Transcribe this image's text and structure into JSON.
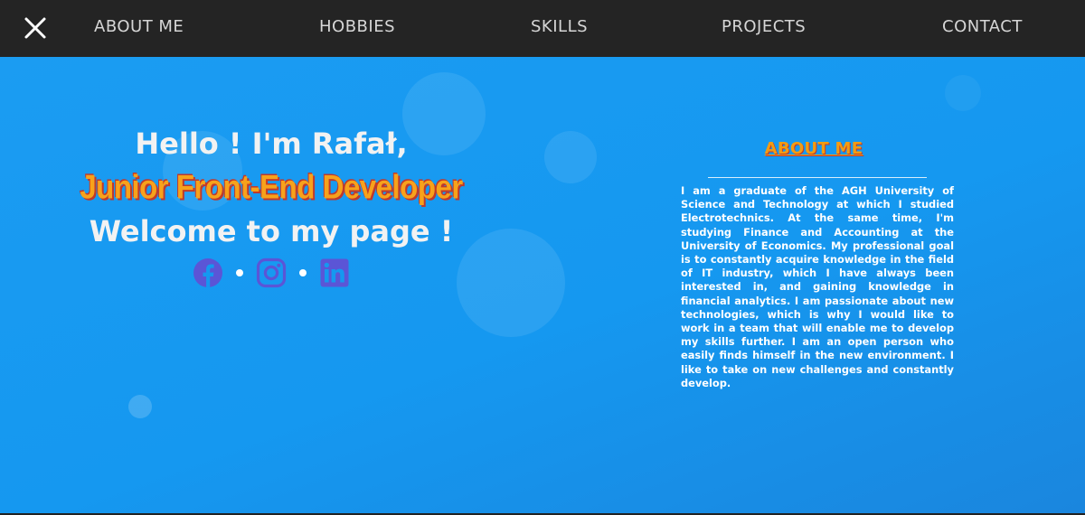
{
  "nav": {
    "items": [
      {
        "label": "ABOUT ME"
      },
      {
        "label": "HOBBIES"
      },
      {
        "label": "SKILLS"
      },
      {
        "label": "PROJECTS"
      },
      {
        "label": "CONTACT"
      }
    ],
    "close_icon": "close-icon"
  },
  "hero": {
    "greeting": "Hello ! I'm Rafał,",
    "role": "Junior Front-End Developer",
    "welcome": "Welcome to my page !",
    "social_icons": [
      "facebook-icon",
      "instagram-icon",
      "linkedin-icon"
    ]
  },
  "about": {
    "heading": "ABOUT ME",
    "text": "I am a graduate of the AGH University of Science and Technology at which I studied Electrotechnics. At the same time, I'm studying Finance and Accounting at the University of Economics. My professional goal is to constantly acquire knowledge in the field of IT industry, which I have always been interested in, and gaining knowledge in financial analytics. I am passionate about new technologies, which is why I would like to work in a team that will enable me to develop my skills further. I am an open person who easily finds himself in the new environment. I like to take on new challenges and constantly develop."
  },
  "colors": {
    "topbar": "#242424",
    "hero_background": "#1598f0",
    "accent_orange": "#f7a21b",
    "accent_red_outline": "#c0392b",
    "social_icon_purple": "#5b55d6"
  }
}
